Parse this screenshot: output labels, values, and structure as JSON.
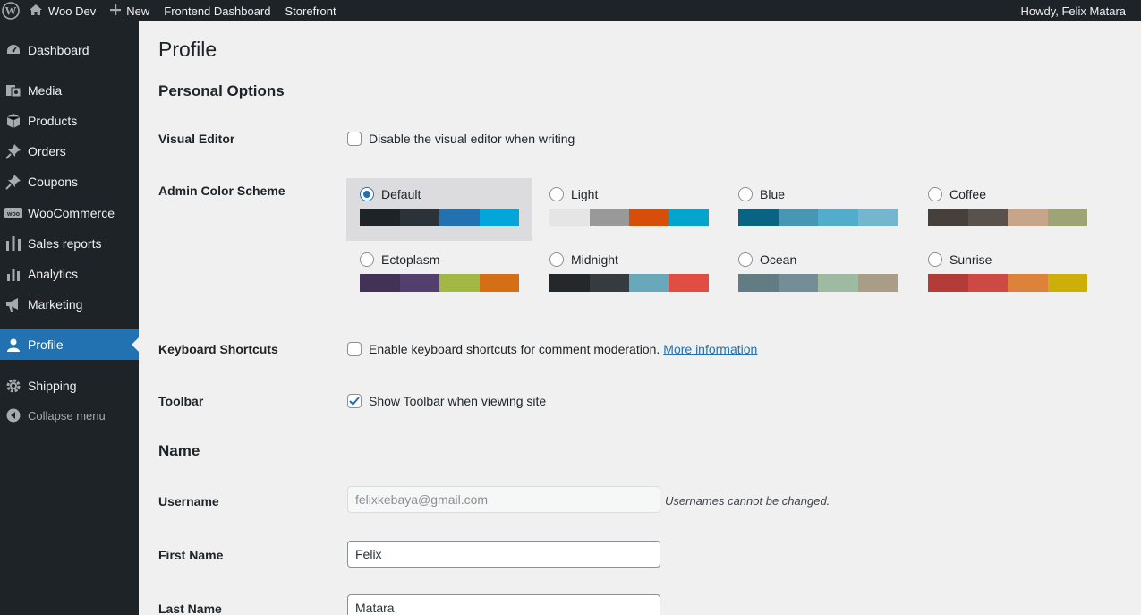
{
  "adminbar": {
    "site_name": "Woo Dev",
    "new_label": "New",
    "frontend_dashboard": "Frontend Dashboard",
    "storefront": "Storefront",
    "howdy": "Howdy, Felix Matara"
  },
  "sidebar": {
    "items": [
      {
        "label": "Dashboard",
        "icon": "dashboard-icon"
      },
      {
        "label": "Media",
        "icon": "media-icon"
      },
      {
        "label": "Products",
        "icon": "products-icon"
      },
      {
        "label": "Orders",
        "icon": "pin-icon"
      },
      {
        "label": "Coupons",
        "icon": "pin-icon"
      },
      {
        "label": "WooCommerce",
        "icon": "woo-icon"
      },
      {
        "label": "Sales reports",
        "icon": "bars-icon"
      },
      {
        "label": "Analytics",
        "icon": "chart-icon"
      },
      {
        "label": "Marketing",
        "icon": "megaphone-icon"
      },
      {
        "label": "Profile",
        "icon": "user-icon",
        "current": true
      },
      {
        "label": "Shipping",
        "icon": "gear-icon"
      },
      {
        "label": "Collapse menu",
        "icon": "collapse-icon"
      }
    ]
  },
  "page": {
    "title": "Profile",
    "personal_options": "Personal Options",
    "visual_editor_label": "Visual Editor",
    "visual_editor_text": "Disable the visual editor when writing",
    "visual_editor_checked": false,
    "color_scheme_label": "Admin Color Scheme",
    "keyboard_label": "Keyboard Shortcuts",
    "keyboard_text": "Enable keyboard shortcuts for comment moderation.",
    "keyboard_link": "More information",
    "keyboard_checked": false,
    "toolbar_label": "Toolbar",
    "toolbar_text": "Show Toolbar when viewing site",
    "toolbar_checked": true,
    "name_section": "Name",
    "username_label": "Username",
    "username_value": "felixkebaya@gmail.com",
    "username_hint": "Usernames cannot be changed.",
    "first_name_label": "First Name",
    "first_name_value": "Felix",
    "last_name_label": "Last Name",
    "last_name_value": "Matara"
  },
  "color_schemes": [
    {
      "name": "Default",
      "selected": true,
      "colors": [
        "#1d2327",
        "#2c3338",
        "#2271b1",
        "#72aee6"
      ]
    },
    {
      "name": "Light",
      "selected": false,
      "colors": [
        "#e5e5e5",
        "#999999",
        "#d64e07",
        "#04a4cc"
      ]
    },
    {
      "name": "Blue",
      "selected": false,
      "colors": [
        "#096484",
        "#4796b3",
        "#52accc",
        "#74b6ce"
      ]
    },
    {
      "name": "Coffee",
      "selected": false,
      "colors": [
        "#46403c",
        "#59524c",
        "#c7a589",
        "#9ea476"
      ]
    },
    {
      "name": "Ectoplasm",
      "selected": false,
      "colors": [
        "#413256",
        "#523f6d",
        "#a3b745",
        "#d46f15"
      ]
    },
    {
      "name": "Midnight",
      "selected": false,
      "colors": [
        "#25282b",
        "#363b3f",
        "#69a8bb",
        "#e14d43"
      ]
    },
    {
      "name": "Ocean",
      "selected": false,
      "colors": [
        "#627c83",
        "#738e96",
        "#9ebaa0",
        "#aa9d88"
      ]
    },
    {
      "name": "Sunrise",
      "selected": false,
      "colors": [
        "#b43c38",
        "#cf4944",
        "#dd823b",
        "#ccaf0b"
      ]
    }
  ],
  "colors": {
    "accent": "#2271b1",
    "sidebar_bg": "#1d2327"
  }
}
